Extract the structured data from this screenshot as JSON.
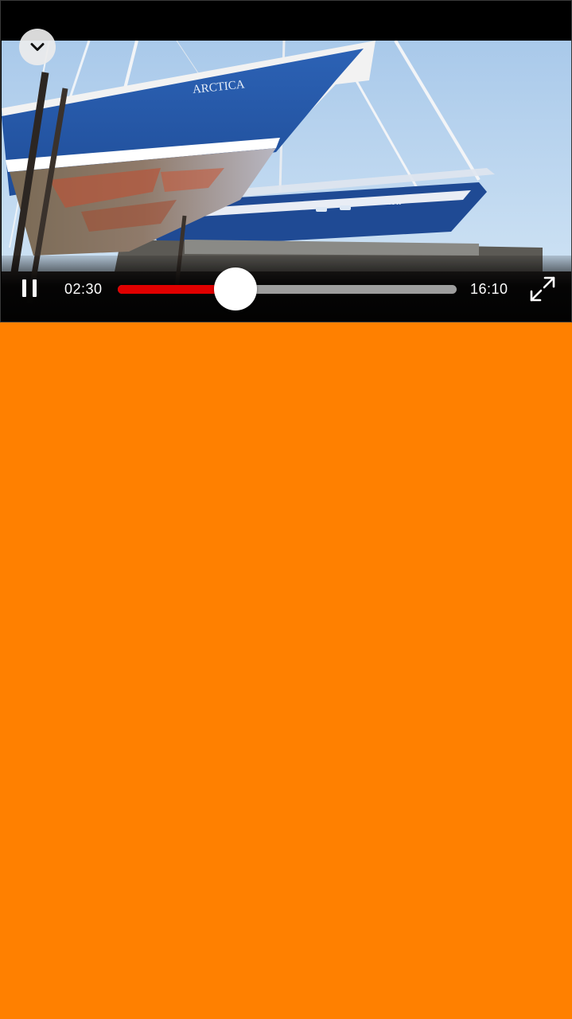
{
  "player": {
    "current_time": "02:30",
    "total_time": "16:10",
    "progress_fraction": 0.347,
    "state": "playing",
    "colors": {
      "progress_fill": "#E00000",
      "progress_track": "#9E9E9E",
      "page_background": "#FF8000"
    }
  },
  "video": {
    "boat_name_front": "ARCTICA",
    "boat_name_back": "ARCTICA II"
  },
  "icons": {
    "collapse": "chevron-down-icon",
    "pause": "pause-icon",
    "fullscreen": "fullscreen-icon"
  }
}
